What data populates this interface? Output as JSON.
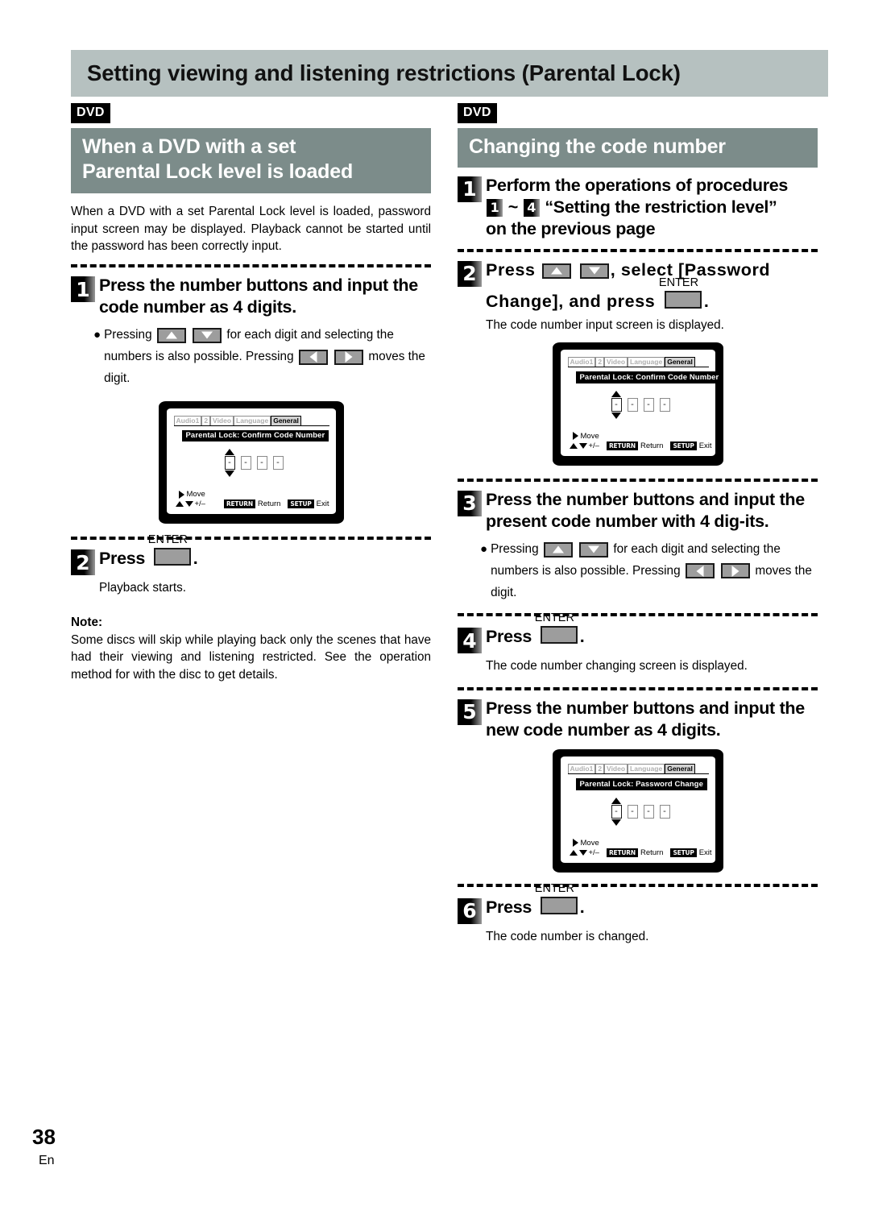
{
  "page": {
    "title": "Setting viewing and listening restrictions (Parental Lock)",
    "number": "38",
    "language_code": "En"
  },
  "colors": {
    "title_bar": "#b6c1c0",
    "section_heading": "#7c8c8a",
    "badge": "#000000",
    "key_face": "#9d9d9d"
  },
  "left_column": {
    "badge": "DVD",
    "heading_line1": "When a DVD with a set",
    "heading_line2": "Parental Lock level is loaded",
    "intro": "When a DVD with a set Parental Lock level is loaded, password input screen may be displayed. Playback cannot be started until the password has been correctly input.",
    "step1": {
      "number": "1",
      "text": "Press the number buttons and input the code number as 4 digits.",
      "bullet_part1": "Pressing",
      "bullet_part2": "for each digit and selecting the numbers is also possible. Pressing",
      "bullet_part3": "moves the digit."
    },
    "step2": {
      "number": "2",
      "press_label": "Press",
      "enter_label": "ENTER",
      "period": ".",
      "result": "Playback starts."
    },
    "note": {
      "label": "Note:",
      "text": "Some discs will skip while playing back only the scenes that have had their viewing and listening restricted.  See the operation method for with the disc to get details."
    },
    "osd": {
      "tabs": [
        "Audio1",
        "2",
        "Video",
        "Language",
        "General"
      ],
      "active_tab": "General",
      "title": "Parental Lock: Confirm Code Number",
      "digits": [
        "-",
        "-",
        "-",
        "-"
      ],
      "footer": {
        "move_label": "Move",
        "plus_minus_label": "+/–",
        "return_key": "RETURN",
        "return_label": "Return",
        "setup_key": "SETUP",
        "exit_label": "Exit"
      }
    }
  },
  "right_column": {
    "badge": "DVD",
    "heading": "Changing the code number",
    "step1": {
      "number": "1",
      "text_part1": "Perform the operations of procedures",
      "chip_from": "1",
      "tilde": "~",
      "chip_to": "4",
      "text_part2": "“Setting the  restriction level”",
      "text_part3": "on the previous page"
    },
    "step2": {
      "number": "2",
      "press_label": "Press",
      "select_label": ", select [Password",
      "line2_label": "Change], and press",
      "enter_label": "ENTER",
      "period": ".",
      "result": "The code number input screen is displayed."
    },
    "step3": {
      "number": "3",
      "text": "Press the number buttons and input the present code number with 4 dig-its.",
      "bullet_part1": "Pressing",
      "bullet_part2": "for each digit and selecting the numbers is also possible. Pressing",
      "bullet_part3": "moves the digit."
    },
    "step4": {
      "number": "4",
      "press_label": "Press",
      "enter_label": "ENTER",
      "period": ".",
      "result": "The code number changing screen is displayed."
    },
    "step5": {
      "number": "5",
      "text": "Press the number buttons and input the new code number as 4 digits."
    },
    "step6": {
      "number": "6",
      "press_label": "Press",
      "enter_label": "ENTER",
      "period": ".",
      "result": "The code number is changed."
    },
    "osd_confirm": {
      "tabs": [
        "Audio1",
        "2",
        "Video",
        "Language",
        "General"
      ],
      "active_tab": "General",
      "title": "Parental Lock: Confirm Code Number",
      "digits": [
        "-",
        "-",
        "-",
        "-"
      ],
      "footer": {
        "move_label": "Move",
        "plus_minus_label": "+/–",
        "return_key": "RETURN",
        "return_label": "Return",
        "setup_key": "SETUP",
        "exit_label": "Exit"
      }
    },
    "osd_change": {
      "tabs": [
        "Audio1",
        "2",
        "Video",
        "Language",
        "General"
      ],
      "active_tab": "General",
      "title": "Parental Lock: Password Change",
      "digits": [
        "-",
        "-",
        "-",
        "-"
      ],
      "footer": {
        "move_label": "Move",
        "plus_minus_label": "+/–",
        "return_key": "RETURN",
        "return_label": "Return",
        "setup_key": "SETUP",
        "exit_label": "Exit"
      }
    }
  }
}
